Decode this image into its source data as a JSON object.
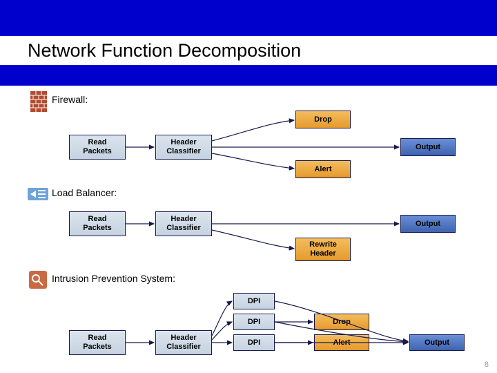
{
  "title": "Network Function Decomposition",
  "page_number": "8",
  "sections": {
    "firewall": {
      "label": "Firewall:"
    },
    "loadbalancer": {
      "label": "Load Balancer:"
    },
    "ips": {
      "label": "Intrusion Prevention System:"
    }
  },
  "nodes": {
    "read_packets": "Read\nPackets",
    "header_classifier": "Header\nClassifier",
    "drop": "Drop",
    "alert": "Alert",
    "output": "Output",
    "rewrite_header": "Rewrite\nHeader",
    "dpi": "DPI"
  },
  "chart_data": {
    "type": "table",
    "title": "Network Function Decomposition",
    "functions": [
      {
        "name": "Firewall",
        "pipeline": [
          "Read Packets",
          "Header Classifier"
        ],
        "actions": [
          "Drop",
          "Alert",
          "Output"
        ]
      },
      {
        "name": "Load Balancer",
        "pipeline": [
          "Read Packets",
          "Header Classifier"
        ],
        "actions": [
          "Rewrite Header",
          "Output"
        ]
      },
      {
        "name": "Intrusion Prevention System",
        "pipeline": [
          "Read Packets",
          "Header Classifier",
          "DPI"
        ],
        "actions": [
          "Drop",
          "Alert",
          "Output"
        ]
      }
    ]
  }
}
